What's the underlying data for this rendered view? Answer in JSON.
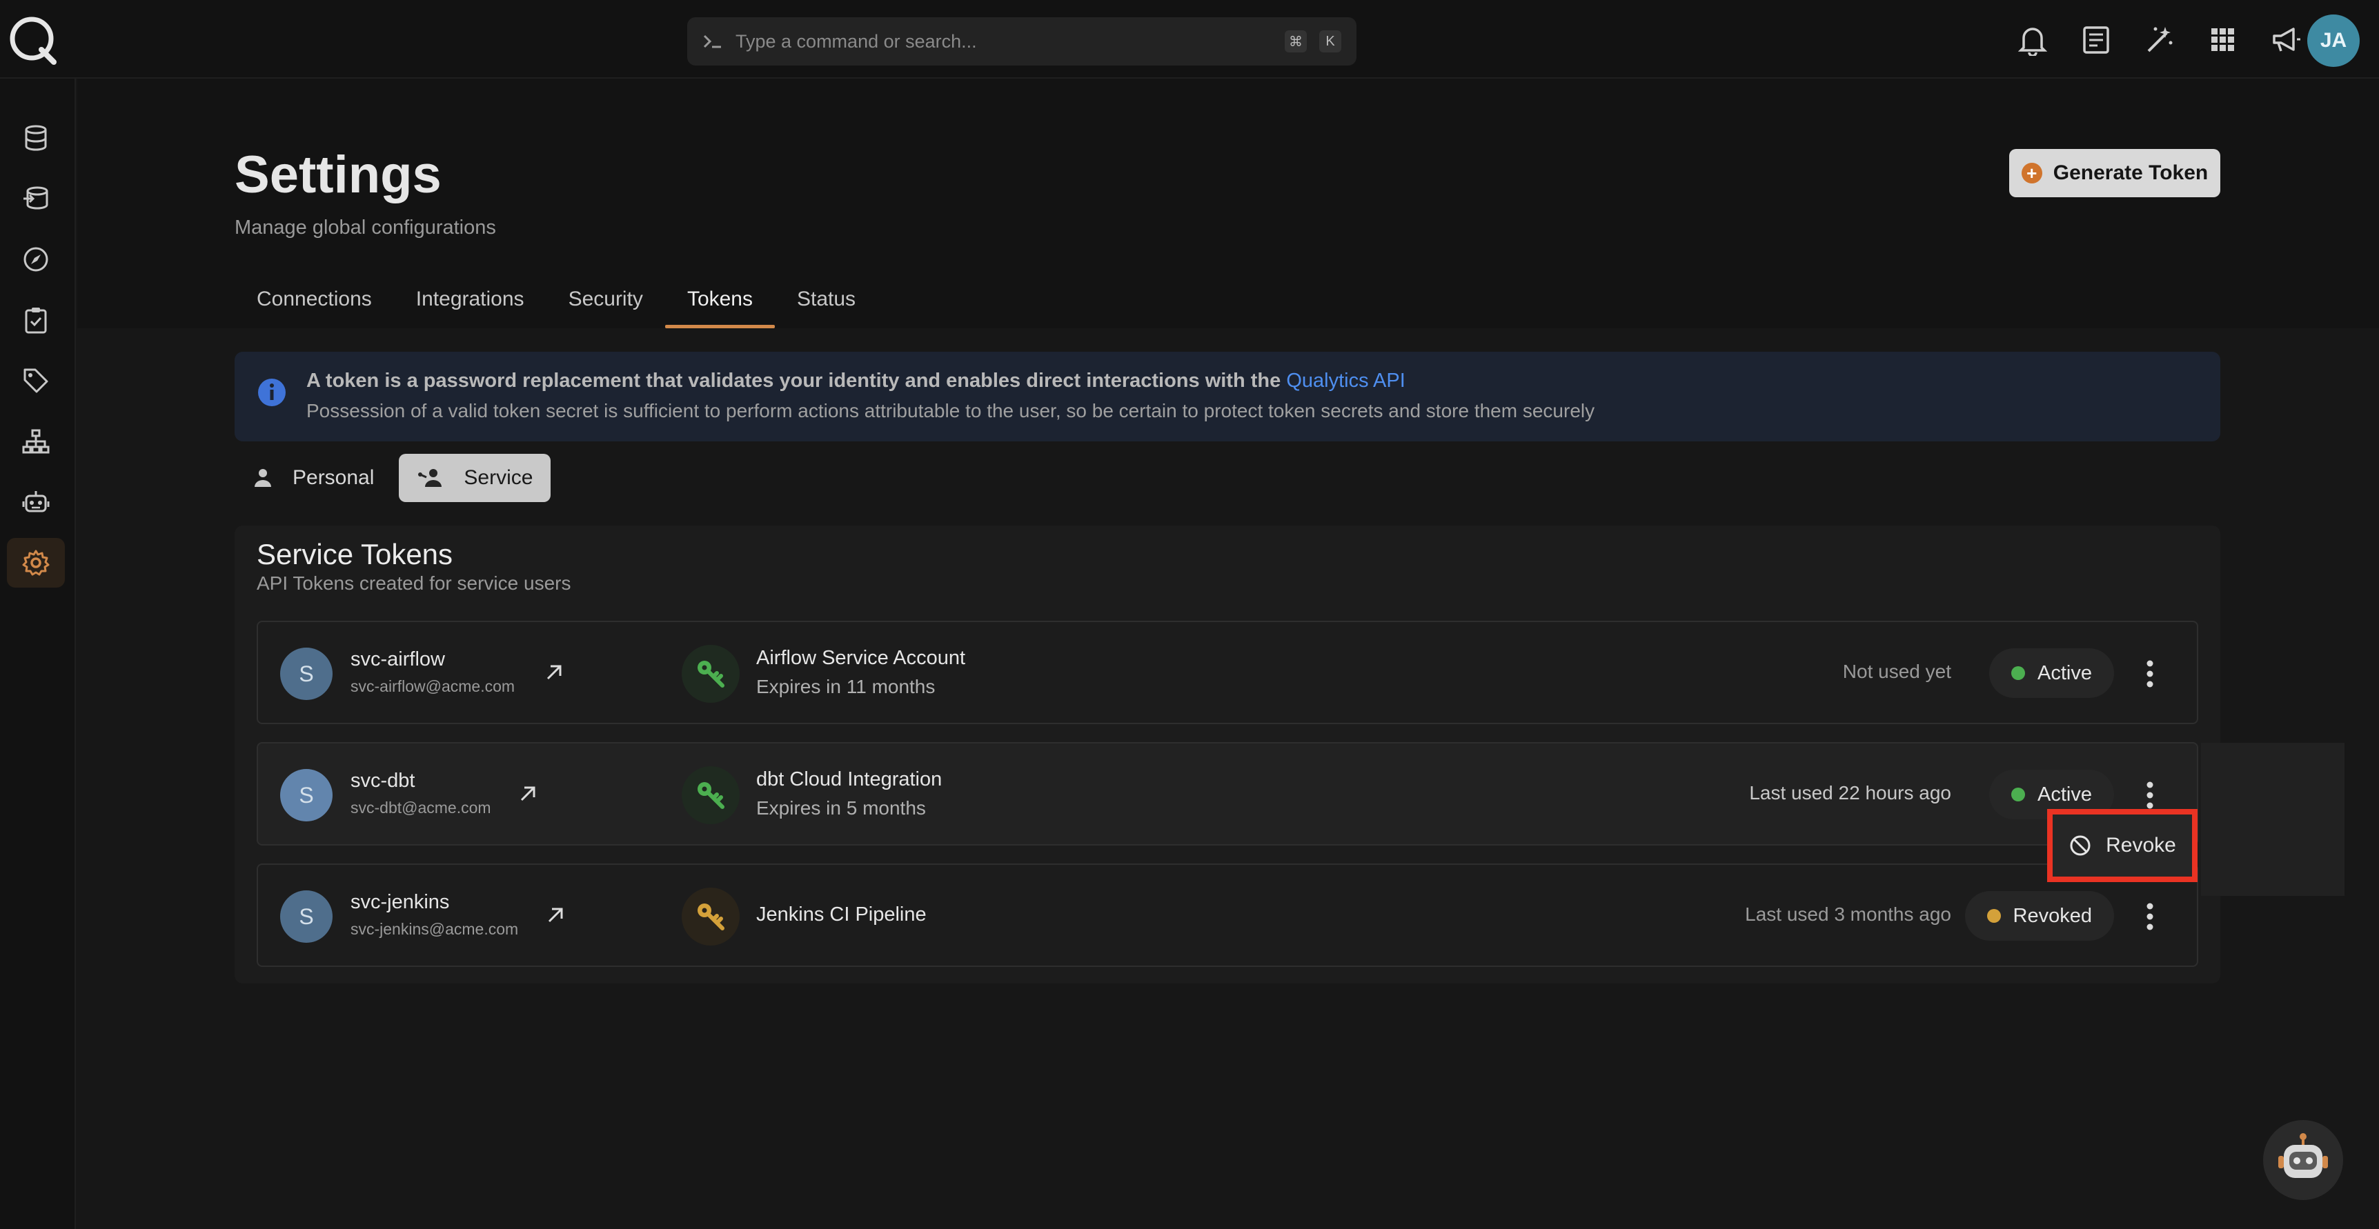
{
  "command": {
    "placeholder": "Type a command or search...",
    "key1": "⌘",
    "key2": "K"
  },
  "user": {
    "initials": "JA"
  },
  "topbar_icons": [
    "bell-icon",
    "document-icon",
    "magic-wand-icon",
    "grid-icon",
    "megaphone-icon"
  ],
  "sidebar_icons": [
    "database-icon",
    "datastore-stack-icon",
    "compass-icon",
    "checklist-icon",
    "tag-icon",
    "hierarchy-icon",
    "robot-icon",
    "gear-icon"
  ],
  "page": {
    "title": "Settings",
    "subtitle": "Manage global configurations",
    "generate_label": "Generate Token",
    "generate_icon": "+"
  },
  "tabs": [
    "Connections",
    "Integrations",
    "Security",
    "Tokens",
    "Status"
  ],
  "active_tab": "Tokens",
  "info": {
    "line1": "A token is a password replacement that validates your identity and enables direct interactions with the",
    "link": "Qualytics API",
    "line2": "Possession of a valid token secret is sufficient to perform actions attributable to the user, so be certain to protect token secrets and store them securely"
  },
  "segments": {
    "personal": "Personal",
    "service": "Service"
  },
  "card": {
    "title": "Service Tokens",
    "subtitle": "API Tokens created for service users"
  },
  "tokens": [
    {
      "initial": "S",
      "user": "svc-airflow",
      "email": "svc-airflow@acme.com",
      "token_name": "Airflow Service Account",
      "expires": "Expires in 11 months",
      "last_used": "Not used yet",
      "status": "Active"
    },
    {
      "initial": "S",
      "user": "svc-dbt",
      "email": "svc-dbt@acme.com",
      "token_name": "dbt Cloud Integration",
      "expires": "Expires in 5 months",
      "last_used": "Last used 22 hours ago",
      "status": "Active"
    },
    {
      "initial": "S",
      "user": "svc-jenkins",
      "email": "svc-jenkins@acme.com",
      "token_name": "Jenkins CI Pipeline",
      "expires": "",
      "last_used": "Last used 3 months ago",
      "status": "Revoked"
    }
  ],
  "menu": {
    "revoke_label": "Revoke"
  },
  "colors": {
    "accent": "#d2894a",
    "active": "#4caf50",
    "revoked": "#d4a13a",
    "highlight": "#ea3323",
    "link": "#4f8ff0"
  }
}
